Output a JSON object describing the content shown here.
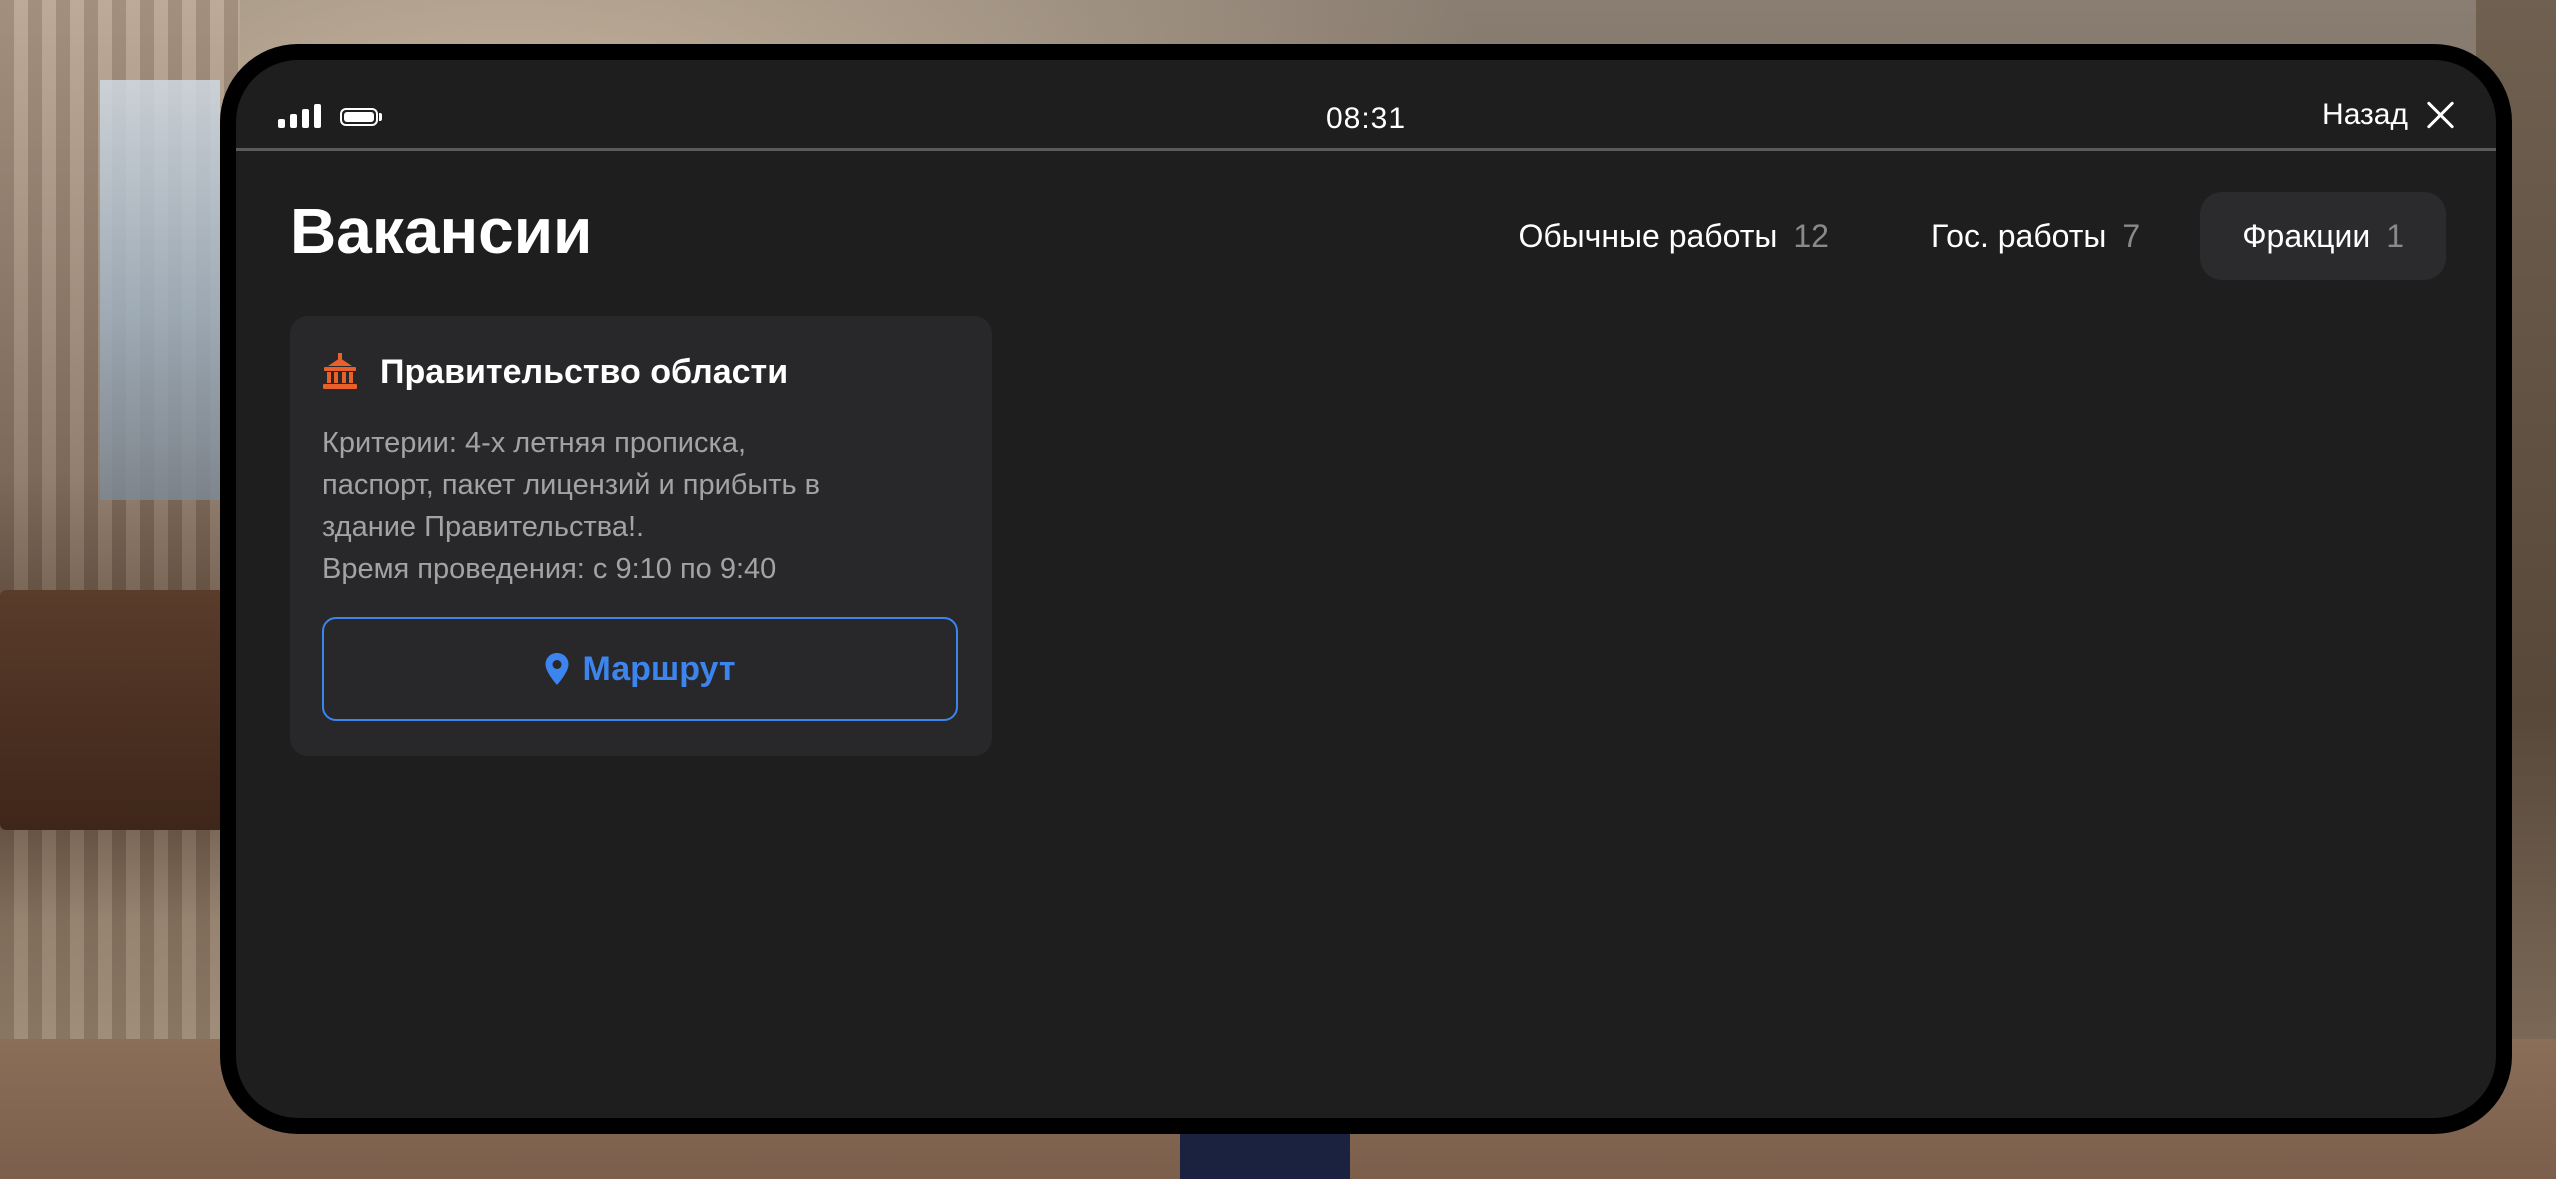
{
  "status_bar": {
    "time": "08:31",
    "back_label": "Назад",
    "icons": [
      "signal-icon",
      "battery-icon",
      "close-icon"
    ]
  },
  "header": {
    "title": "Вакансии",
    "tabs": [
      {
        "label": "Обычные работы",
        "count": "12",
        "active": false
      },
      {
        "label": "Гос. работы",
        "count": "7",
        "active": false
      },
      {
        "label": "Фракции",
        "count": "1",
        "active": true
      }
    ]
  },
  "cards": [
    {
      "icon": "government-building-icon",
      "title": "Правительство области",
      "description_lines": [
        "Критерии: 4-х летняя прописка,",
        "паспорт, пакет лицензий и прибыть в",
        "здание Правительства!.",
        "Время проведения: с 9:10 по 9:40"
      ],
      "route_label": "Маршрут",
      "route_icon": "map-pin-icon"
    }
  ],
  "colors": {
    "screen_bg": "#1e1e1f",
    "card_bg": "#28282a",
    "accent": "#3c84ee",
    "icon_orange": "#e8602a",
    "muted_text": "#a3a3a6"
  }
}
